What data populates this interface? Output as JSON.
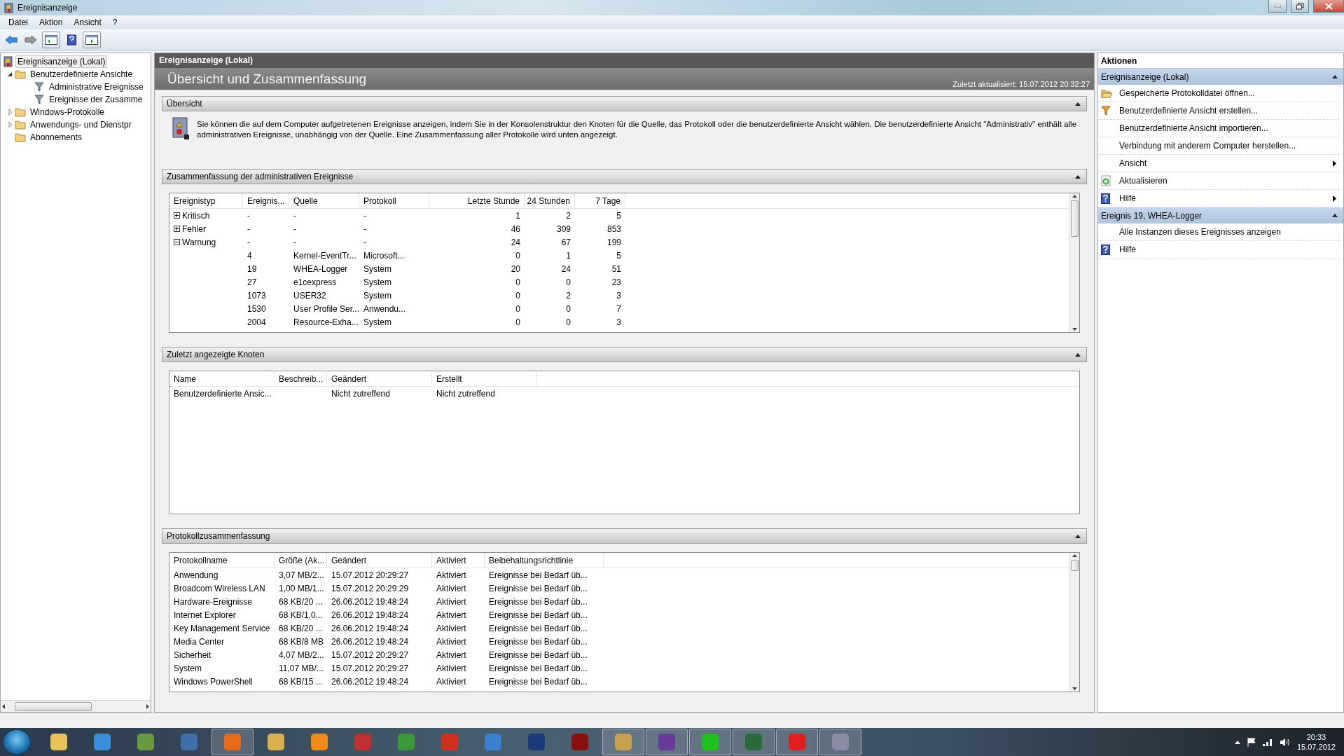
{
  "window": {
    "title": "Ereignisanzeige"
  },
  "menu": [
    "Datei",
    "Aktion",
    "Ansicht",
    "?"
  ],
  "tree": [
    {
      "label": "Ereignisanzeige (Lokal)",
      "kind": "root",
      "selected": true,
      "children": [
        {
          "label": "Benutzerdefinierte Ansichte",
          "kind": "folder",
          "selected": false,
          "expanded": true,
          "children": [
            {
              "label": "Administrative Ereignisse",
              "kind": "filter",
              "selected": false
            },
            {
              "label": "Ereignisse der Zusamme",
              "kind": "filter",
              "selected": false
            }
          ]
        },
        {
          "label": "Windows-Protokolle",
          "kind": "folder",
          "selected": false,
          "expanded": false
        },
        {
          "label": "Anwendungs- und Dienstpr",
          "kind": "folder",
          "selected": false,
          "expanded": false
        },
        {
          "label": "Abonnements",
          "kind": "folder",
          "selected": false
        }
      ]
    }
  ],
  "center": {
    "header": "Ereignisanzeige (Lokal)",
    "title": "Übersicht und Zusammenfassung",
    "updated": "Zuletzt aktualisiert: 15.07.2012 20:32:27",
    "overview": {
      "title": "Übersicht",
      "expanded": true,
      "text": "Sie können die auf dem Computer aufgetretenen Ereignisse anzeigen, indem Sie in der Konsolenstruktur den Knoten für die Quelle, das Protokoll oder die benutzerdefinierte Ansicht wählen. Die benutzerdefinierte Ansicht \"Administrativ\" enthält alle administrativen Ereignisse, unabhängig von der Quelle. Eine Zusammenfassung aller Protokolle wird unten angezeigt."
    },
    "events": {
      "title": "Zusammenfassung der administrativen Ereignisse",
      "expanded": true,
      "columns": [
        "Ereignistyp",
        "Ereignis...",
        "Quelle",
        "Protokoll",
        "Letzte Stunde",
        "24 Stunden",
        "7 Tage"
      ],
      "rows": [
        {
          "expanded": false,
          "cells": [
            "Kritisch",
            "-",
            "-",
            "-",
            "1",
            "2",
            "5"
          ]
        },
        {
          "expanded": false,
          "cells": [
            "Fehler",
            "-",
            "-",
            "-",
            "46",
            "309",
            "853"
          ]
        },
        {
          "expanded": true,
          "cells": [
            "Warnung",
            "-",
            "-",
            "-",
            "24",
            "67",
            "199"
          ],
          "children": [
            {
              "cells": [
                "",
                "4",
                "Kernel-EventTr...",
                "Microsoft...",
                "0",
                "1",
                "5"
              ]
            },
            {
              "cells": [
                "",
                "19",
                "WHEA-Logger",
                "System",
                "20",
                "24",
                "51"
              ]
            },
            {
              "cells": [
                "",
                "27",
                "e1cexpress",
                "System",
                "0",
                "0",
                "23"
              ]
            },
            {
              "cells": [
                "",
                "1073",
                "USER32",
                "System",
                "0",
                "2",
                "3"
              ]
            },
            {
              "cells": [
                "",
                "1530",
                "User Profile Ser...",
                "Anwendu...",
                "0",
                "0",
                "7"
              ]
            },
            {
              "cells": [
                "",
                "2004",
                "Resource-Exha...",
                "System",
                "0",
                "0",
                "3"
              ]
            }
          ]
        }
      ]
    },
    "recent": {
      "title": "Zuletzt angezeigte Knoten",
      "expanded": true,
      "columns": [
        "Name",
        "Beschreib...",
        "Geändert",
        "Erstellt"
      ],
      "rows": [
        [
          "Benutzerdefinierte Ansic...",
          "",
          "Nicht zutreffend",
          "Nicht zutreffend"
        ]
      ]
    },
    "logs": {
      "title": "Protokollzusammenfassung",
      "expanded": true,
      "columns": [
        "Protokollname",
        "Größe (Ak...",
        "Geändert",
        "Aktiviert",
        "Beibehaltungsrichtlinie"
      ],
      "rows": [
        [
          "Anwendung",
          "3,07 MB/2...",
          "15.07.2012 20:29:27",
          "Aktiviert",
          "Ereignisse bei Bedarf üb..."
        ],
        [
          "Broadcom Wireless LAN",
          "1,00 MB/1...",
          "15.07.2012 20:29:29",
          "Aktiviert",
          "Ereignisse bei Bedarf üb..."
        ],
        [
          "Hardware-Ereignisse",
          "68 KB/20 ...",
          "26.06.2012 19:48:24",
          "Aktiviert",
          "Ereignisse bei Bedarf üb..."
        ],
        [
          "Internet Explorer",
          "68 KB/1,0...",
          "26.06.2012 19:48:24",
          "Aktiviert",
          "Ereignisse bei Bedarf üb..."
        ],
        [
          "Key Management Service",
          "68 KB/20 ...",
          "26.06.2012 19:48:24",
          "Aktiviert",
          "Ereignisse bei Bedarf üb..."
        ],
        [
          "Media Center",
          "68 KB/8 MB",
          "26.06.2012 19:48:24",
          "Aktiviert",
          "Ereignisse bei Bedarf üb..."
        ],
        [
          "Sicherheit",
          "4,07 MB/2...",
          "15.07.2012 20:29:27",
          "Aktiviert",
          "Ereignisse bei Bedarf üb..."
        ],
        [
          "System",
          "11,07 MB/...",
          "15.07.2012 20:29:27",
          "Aktiviert",
          "Ereignisse bei Bedarf üb..."
        ],
        [
          "Windows PowerShell",
          "68 KB/15 ...",
          "26.06.2012 19:48:24",
          "Aktiviert",
          "Ereignisse bei Bedarf üb..."
        ]
      ]
    }
  },
  "actions": {
    "title": "Aktionen",
    "groups": [
      {
        "title": "Ereignisanzeige (Lokal)",
        "expanded": true,
        "items": [
          {
            "label": "Gespeicherte Protokolldatei öffnen...",
            "kind": "open",
            "submenu": false
          },
          {
            "label": "Benutzerdefinierte Ansicht erstellen...",
            "kind": "filter",
            "submenu": false
          },
          {
            "label": "Benutzerdefinierte Ansicht importieren...",
            "kind": "plain",
            "submenu": false
          },
          {
            "label": "Verbindung mit anderem Computer herstellen...",
            "kind": "plain",
            "submenu": false
          },
          {
            "label": "Ansicht",
            "kind": "plain",
            "submenu": true
          },
          {
            "label": "Aktualisieren",
            "kind": "refresh",
            "submenu": false
          },
          {
            "label": "Hilfe",
            "kind": "help",
            "submenu": true
          }
        ]
      },
      {
        "title": "Ereignis 19, WHEA-Logger",
        "expanded": true,
        "items": [
          {
            "label": "Alle Instanzen dieses Ereignisses anzeigen",
            "kind": "plain",
            "submenu": false
          },
          {
            "label": "Hilfe",
            "kind": "help",
            "submenu": false
          }
        ]
      }
    ]
  },
  "taskbar": {
    "apps": [
      {
        "color": "#e8c35a",
        "running": false
      },
      {
        "color": "#3a8fd8",
        "running": false
      },
      {
        "color": "#6a9a40",
        "running": false
      },
      {
        "color": "#3e6fa8",
        "running": false
      },
      {
        "color": "#e66a1a",
        "running": true
      },
      {
        "color": "#d8b050",
        "running": false
      },
      {
        "color": "#f28a1a",
        "running": false
      },
      {
        "color": "#c03030",
        "running": false
      },
      {
        "color": "#3a9a3a",
        "running": false
      },
      {
        "color": "#d03020",
        "running": false
      },
      {
        "color": "#3a80d0",
        "running": false
      },
      {
        "color": "#1a3a7a",
        "running": false
      },
      {
        "color": "#8a1010",
        "running": false
      },
      {
        "color": "#c8a050",
        "running": true
      },
      {
        "color": "#6a3a9a",
        "running": true
      },
      {
        "color": "#20c020",
        "running": true
      },
      {
        "color": "#2a6a3a",
        "running": true
      },
      {
        "color": "#e02020",
        "running": true
      },
      {
        "color": "#8a8aa0",
        "running": true
      }
    ],
    "time": "20:33",
    "date": "15.07.2012"
  }
}
